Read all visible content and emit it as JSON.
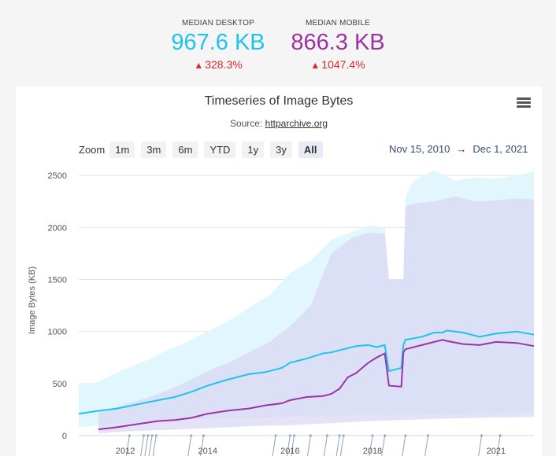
{
  "summary": {
    "desktop": {
      "label": "MEDIAN DESKTOP",
      "value": "967.6 KB",
      "change": "328.3%",
      "color": "#1ec4ef"
    },
    "mobile": {
      "label": "MEDIAN MOBILE",
      "value": "866.3 KB",
      "change": "1047.4%",
      "color": "#9e32a5"
    },
    "change_color": "#e0262d"
  },
  "chart": {
    "title": "Timeseries of Image Bytes",
    "source_prefix": "Source: ",
    "source_link": "httparchive.org",
    "menu_icon": "hamburger-menu-icon"
  },
  "zoom": {
    "label": "Zoom",
    "buttons": [
      "1m",
      "3m",
      "6m",
      "YTD",
      "1y",
      "3y",
      "All"
    ],
    "active": "All"
  },
  "range": {
    "from": "Nov 15, 2010",
    "to": "Dec 1, 2021",
    "separator": "→"
  },
  "chart_data": {
    "type": "area",
    "title": "Timeseries of Image Bytes",
    "ylabel": "Image Bytes (KB)",
    "ylim": [
      0,
      2600
    ],
    "yticks": [
      0,
      500,
      1000,
      1500,
      2000,
      2500
    ],
    "xlim": [
      2010.87,
      2021.92
    ],
    "xticks": [
      {
        "value": 2012,
        "label": "2012"
      },
      {
        "value": 2014,
        "label": "2014"
      },
      {
        "value": 2016,
        "label": "2016"
      },
      {
        "value": 2018,
        "label": "2018"
      },
      {
        "value": 2021,
        "label": "2021"
      }
    ],
    "grid": true,
    "series": [
      {
        "key": "desktop",
        "color": "#1ec4ef",
        "median": [
          [
            2010.87,
            210
          ],
          [
            2011.3,
            235
          ],
          [
            2011.8,
            260
          ],
          [
            2012.3,
            300
          ],
          [
            2012.8,
            340
          ],
          [
            2013.2,
            370
          ],
          [
            2013.6,
            420
          ],
          [
            2014.0,
            480
          ],
          [
            2014.5,
            540
          ],
          [
            2015.0,
            590
          ],
          [
            2015.4,
            610
          ],
          [
            2015.8,
            650
          ],
          [
            2016.0,
            700
          ],
          [
            2016.4,
            740
          ],
          [
            2016.8,
            790
          ],
          [
            2017.0,
            800
          ],
          [
            2017.3,
            830
          ],
          [
            2017.6,
            860
          ],
          [
            2017.9,
            870
          ],
          [
            2018.1,
            850
          ],
          [
            2018.3,
            870
          ],
          [
            2018.4,
            620
          ],
          [
            2018.7,
            650
          ],
          [
            2018.75,
            870
          ],
          [
            2018.8,
            920
          ],
          [
            2019.2,
            950
          ],
          [
            2019.5,
            990
          ],
          [
            2019.7,
            990
          ],
          [
            2019.8,
            1010
          ],
          [
            2020.2,
            990
          ],
          [
            2020.6,
            950
          ],
          [
            2021.0,
            980
          ],
          [
            2021.5,
            1000
          ],
          [
            2021.92,
            970
          ]
        ],
        "p10": [
          [
            2010.87,
            80
          ],
          [
            2012.0,
            120
          ],
          [
            2013.0,
            140
          ],
          [
            2014.0,
            160
          ],
          [
            2015.0,
            170
          ],
          [
            2016.0,
            180
          ],
          [
            2017.0,
            190
          ],
          [
            2018.0,
            200
          ],
          [
            2018.4,
            190
          ],
          [
            2018.8,
            210
          ],
          [
            2019.5,
            210
          ],
          [
            2020.5,
            220
          ],
          [
            2021.92,
            230
          ]
        ],
        "p90": [
          [
            2010.87,
            490
          ],
          [
            2011.3,
            510
          ],
          [
            2012.0,
            640
          ],
          [
            2012.5,
            720
          ],
          [
            2013.0,
            820
          ],
          [
            2013.5,
            900
          ],
          [
            2014.0,
            1000
          ],
          [
            2014.5,
            1100
          ],
          [
            2015.0,
            1230
          ],
          [
            2015.5,
            1350
          ],
          [
            2016.0,
            1560
          ],
          [
            2016.5,
            1680
          ],
          [
            2017.0,
            1880
          ],
          [
            2017.5,
            1960
          ],
          [
            2018.0,
            2020
          ],
          [
            2018.3,
            2000
          ],
          [
            2018.4,
            1500
          ],
          [
            2018.75,
            1500
          ],
          [
            2018.8,
            2300
          ],
          [
            2019.0,
            2450
          ],
          [
            2019.5,
            2550
          ],
          [
            2020.0,
            2450
          ],
          [
            2020.5,
            2480
          ],
          [
            2021.0,
            2470
          ],
          [
            2021.5,
            2500
          ],
          [
            2021.92,
            2540
          ]
        ]
      },
      {
        "key": "mobile",
        "color": "#9e32a5",
        "median": [
          [
            2011.35,
            60
          ],
          [
            2011.8,
            80
          ],
          [
            2012.3,
            110
          ],
          [
            2012.8,
            140
          ],
          [
            2013.2,
            150
          ],
          [
            2013.6,
            170
          ],
          [
            2014.0,
            210
          ],
          [
            2014.5,
            240
          ],
          [
            2015.0,
            260
          ],
          [
            2015.4,
            290
          ],
          [
            2015.8,
            310
          ],
          [
            2016.0,
            340
          ],
          [
            2016.4,
            370
          ],
          [
            2016.8,
            380
          ],
          [
            2017.0,
            400
          ],
          [
            2017.2,
            450
          ],
          [
            2017.4,
            560
          ],
          [
            2017.6,
            600
          ],
          [
            2017.9,
            700
          ],
          [
            2018.1,
            750
          ],
          [
            2018.3,
            790
          ],
          [
            2018.4,
            480
          ],
          [
            2018.7,
            470
          ],
          [
            2018.75,
            800
          ],
          [
            2018.8,
            830
          ],
          [
            2019.2,
            870
          ],
          [
            2019.5,
            900
          ],
          [
            2019.7,
            920
          ],
          [
            2019.8,
            910
          ],
          [
            2020.2,
            880
          ],
          [
            2020.6,
            870
          ],
          [
            2021.0,
            900
          ],
          [
            2021.5,
            890
          ],
          [
            2021.92,
            860
          ]
        ],
        "p10": [
          [
            2011.35,
            20
          ],
          [
            2012.0,
            40
          ],
          [
            2013.0,
            55
          ],
          [
            2014.0,
            70
          ],
          [
            2015.0,
            90
          ],
          [
            2016.0,
            100
          ],
          [
            2017.0,
            120
          ],
          [
            2018.0,
            140
          ],
          [
            2018.8,
            150
          ],
          [
            2019.5,
            160
          ],
          [
            2020.5,
            170
          ],
          [
            2021.92,
            180
          ]
        ],
        "p90": [
          [
            2011.35,
            220
          ],
          [
            2012.0,
            300
          ],
          [
            2012.5,
            360
          ],
          [
            2013.0,
            430
          ],
          [
            2013.5,
            520
          ],
          [
            2014.0,
            620
          ],
          [
            2014.5,
            700
          ],
          [
            2015.0,
            800
          ],
          [
            2015.5,
            900
          ],
          [
            2016.0,
            1050
          ],
          [
            2016.5,
            1250
          ],
          [
            2017.0,
            1750
          ],
          [
            2017.5,
            1900
          ],
          [
            2017.9,
            1950
          ],
          [
            2018.3,
            1940
          ],
          [
            2018.4,
            1500
          ],
          [
            2018.75,
            1500
          ],
          [
            2018.8,
            2200
          ],
          [
            2019.0,
            2230
          ],
          [
            2019.5,
            2250
          ],
          [
            2020.0,
            2300
          ],
          [
            2020.5,
            2250
          ],
          [
            2021.0,
            2260
          ],
          [
            2021.5,
            2280
          ],
          [
            2021.92,
            2270
          ]
        ]
      }
    ],
    "flags_x": [
      2012.1,
      2012.45,
      2012.55,
      2012.65,
      2012.75,
      2013.6,
      2013.9,
      2015.65,
      2016.0,
      2016.1,
      2016.5,
      2016.9,
      2017.2,
      2017.3,
      2018.0,
      2018.3,
      2018.8,
      2019.35,
      2020.65,
      2021.1
    ]
  }
}
